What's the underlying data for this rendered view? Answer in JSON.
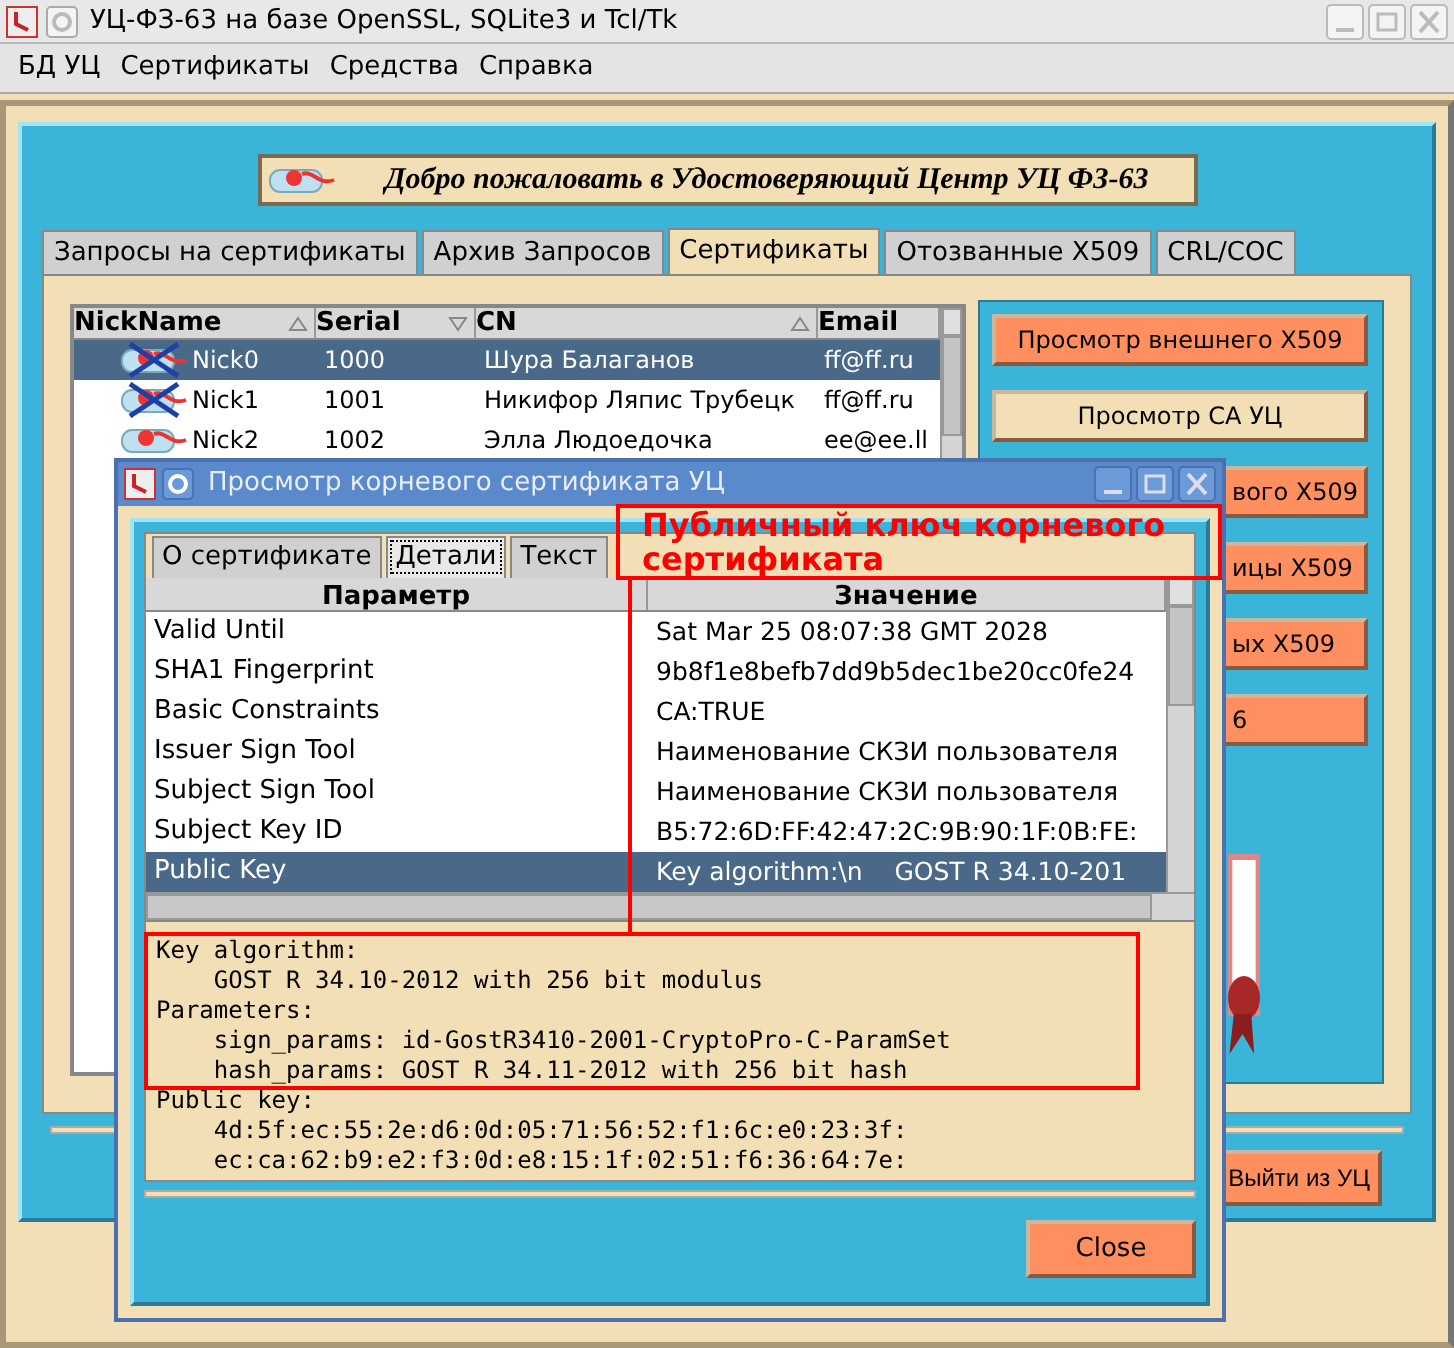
{
  "window": {
    "title": "УЦ-ФЗ-63 на базе OpenSSL, SQLite3 и Tcl/Tk"
  },
  "menu": [
    "БД УЦ",
    "Сертификаты",
    "Средства",
    "Справка"
  ],
  "banner": {
    "text": "Добро пожаловать в Удостоверяющий Центр УЦ ФЗ-63"
  },
  "tabs": [
    {
      "label": "Запросы на сертификаты",
      "selected": false
    },
    {
      "label": "Архив Запросов",
      "selected": false
    },
    {
      "label": "Сертификаты",
      "selected": true
    },
    {
      "label": "Отозванные X509",
      "selected": false
    },
    {
      "label": "CRL/COC",
      "selected": false
    }
  ],
  "certificates": {
    "columns": [
      {
        "label": "NickName",
        "sorted": true,
        "descending": false
      },
      {
        "label": "Serial",
        "sorted": true,
        "descending": true
      },
      {
        "label": "CN",
        "sorted": true,
        "descending": false
      },
      {
        "label": "Email",
        "sorted": false
      }
    ],
    "rows": [
      {
        "nickname": "Nick0",
        "serial": "1000",
        "cn": "Шура Балаганов",
        "email": "ff@ff.ru",
        "revoked": true,
        "selected": true
      },
      {
        "nickname": "Nick1",
        "serial": "1001",
        "cn": "Никифор Ляпис Трубецк",
        "email": "ff@ff.ru",
        "revoked": true,
        "selected": false
      },
      {
        "nickname": "Nick2",
        "serial": "1002",
        "cn": "Элла Людоедочка",
        "email": "ee@ee.ll",
        "revoked": false,
        "selected": false
      }
    ]
  },
  "side_buttons": [
    {
      "label": "Просмотр внешнего X509",
      "kind": "accent"
    },
    {
      "label": "Просмотр СА УЦ",
      "kind": "plain"
    },
    {
      "label": "вого X509",
      "kind": "accent"
    },
    {
      "label": "ицы X509",
      "kind": "accent"
    },
    {
      "label": "ых X509",
      "kind": "accent"
    },
    {
      "label": "6",
      "kind": "accent"
    }
  ],
  "exit_button": "Выйти из УЦ",
  "dialog": {
    "title": "Просмотр корневого сертификата УЦ",
    "tabs": [
      {
        "label": "О сертификате",
        "selected": false
      },
      {
        "label": "Детали",
        "selected": true
      },
      {
        "label": "Текст",
        "selected": false
      }
    ],
    "columns": [
      "Параметр",
      "Значение"
    ],
    "rows": [
      {
        "parameter": "Valid Until",
        "value": "Sat Mar 25 08:07:38 GMT 2028",
        "selected": false
      },
      {
        "parameter": "SHA1 Fingerprint",
        "value": "9b8f1e8befb7dd9b5dec1be20cc0fe24",
        "selected": false
      },
      {
        "parameter": "Basic Constraints",
        "value": "CA:TRUE",
        "selected": false
      },
      {
        "parameter": "Issuer Sign Tool",
        "value": "Наименование СКЗИ пользователя",
        "selected": false
      },
      {
        "parameter": "Subject Sign Tool",
        "value": "Наименование СКЗИ пользователя",
        "selected": false
      },
      {
        "parameter": "Subject Key ID",
        "value": "B5:72:6D:FF:42:47:2C:9B:90:1F:0B:FE:",
        "selected": false
      },
      {
        "parameter": "Public Key",
        "value": "Key algorithm:\\n    GOST R 34.10-201",
        "selected": true
      }
    ],
    "details": [
      "Key algorithm:",
      "    GOST R 34.10-2012 with 256 bit modulus",
      "Parameters:",
      "    sign_params: id-GostR3410-2001-CryptoPro-C-ParamSet",
      "    hash_params: GOST R 34.11-2012 with 256 bit hash",
      "Public key:",
      "    4d:5f:ec:55:2e:d6:0d:05:71:56:52:f1:6c:e0:23:3f:",
      "    ec:ca:62:b9:e2:f3:0d:e8:15:1f:02:51:f6:36:64:7e:"
    ],
    "close_button": "Close"
  },
  "annotation": {
    "text": "Публичный ключ корневого сертификата"
  }
}
